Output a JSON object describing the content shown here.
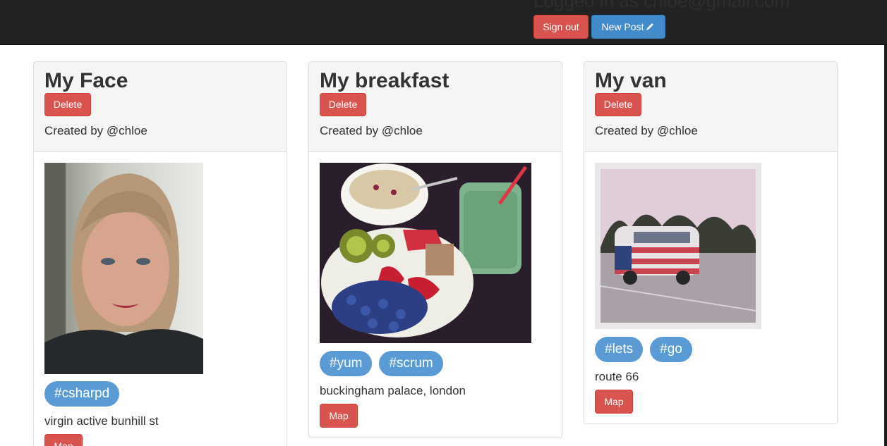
{
  "navbar": {
    "login_text": "Logged in as chloe@gmail.com",
    "signout_label": "Sign out",
    "newpost_label": "New Post"
  },
  "posts": [
    {
      "title": "My Face",
      "delete_label": "Delete",
      "created_by": "Created by @chloe",
      "tags": [
        "#csharpd"
      ],
      "location": "virgin active bunhill st",
      "map_label": "Map"
    },
    {
      "title": "My breakfast",
      "delete_label": "Delete",
      "created_by": "Created by @chloe",
      "tags": [
        "#yum",
        "#scrum"
      ],
      "location": "buckingham palace, london",
      "map_label": "Map"
    },
    {
      "title": "My van",
      "delete_label": "Delete",
      "created_by": "Created by @chloe",
      "tags": [
        "#lets",
        "#go"
      ],
      "location": "route 66",
      "map_label": "Map"
    }
  ]
}
